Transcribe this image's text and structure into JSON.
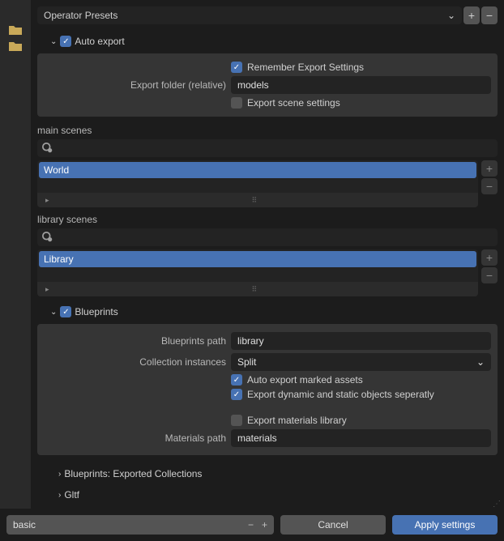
{
  "preset": {
    "label": "Operator Presets"
  },
  "auto_export": {
    "title": "Auto export",
    "checked": true,
    "remember_label": "Remember Export Settings",
    "remember_checked": true,
    "folder_label": "Export folder (relative)",
    "folder_value": "models",
    "export_scene_label": "Export scene settings",
    "export_scene_checked": false
  },
  "main_scenes": {
    "label": "main scenes",
    "items": [
      "World"
    ]
  },
  "library_scenes": {
    "label": "library scenes",
    "items": [
      "Library"
    ]
  },
  "blueprints": {
    "title": "Blueprints",
    "checked": true,
    "path_label": "Blueprints path",
    "path_value": "library",
    "collection_label": "Collection instances",
    "collection_value": "Split",
    "auto_marked_label": "Auto export marked assets",
    "auto_marked_checked": true,
    "dynamic_label": "Export dynamic and static objects seperatly",
    "dynamic_checked": true,
    "mat_lib_label": "Export materials library",
    "mat_lib_checked": false,
    "mat_path_label": "Materials path",
    "mat_path_value": "materials"
  },
  "collapsed": {
    "exported_collections": "Blueprints: Exported Collections",
    "gltf": "Gltf"
  },
  "bottom": {
    "value": "basic",
    "cancel": "Cancel",
    "apply": "Apply settings"
  }
}
